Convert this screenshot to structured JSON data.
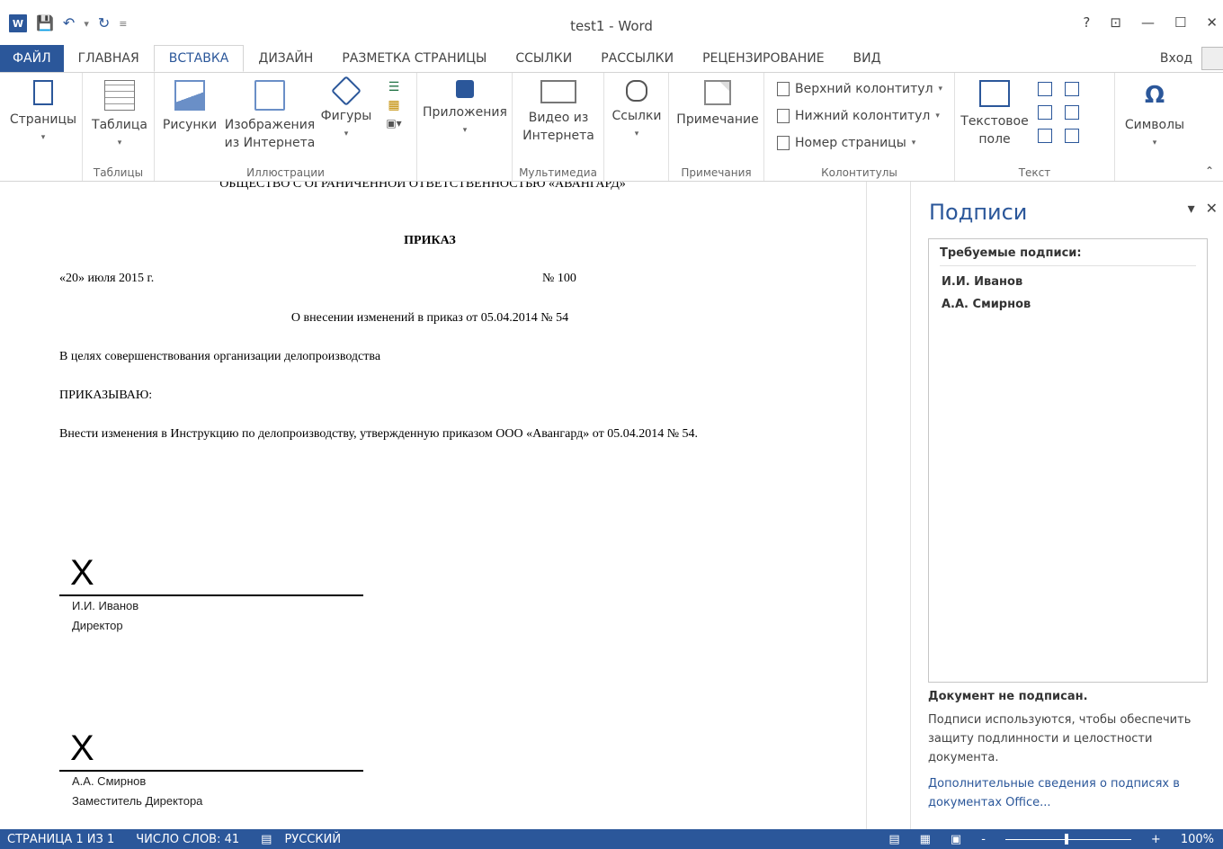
{
  "app": {
    "title": "test1 - Word",
    "logo": "W"
  },
  "window": {
    "help": "?",
    "ribbon_display": "⊡",
    "minimize": "—",
    "maximize": "☐",
    "close": "✕"
  },
  "tabs": {
    "file": "ФАЙЛ",
    "items": [
      "ГЛАВНАЯ",
      "ВСТАВКА",
      "ДИЗАЙН",
      "РАЗМЕТКА СТРАНИЦЫ",
      "ССЫЛКИ",
      "РАССЫЛКИ",
      "РЕЦЕНЗИРОВАНИЕ",
      "ВИД"
    ],
    "active": "ВСТАВКА",
    "signin": "Вход"
  },
  "ribbon": {
    "pages": "Страницы",
    "table": "Таблица",
    "group_tables": "Таблицы",
    "pictures": "Рисунки",
    "online_pictures_1": "Изображения",
    "online_pictures_2": "из Интернета",
    "shapes": "Фигуры",
    "group_illustrations": "Иллюстрации",
    "apps": "Приложения",
    "online_video_1": "Видео из",
    "online_video_2": "Интернета",
    "group_media": "Мультимедиа",
    "links": "Ссылки",
    "comment": "Примечание",
    "group_comments": "Примечания",
    "header": "Верхний колонтитул",
    "footer": "Нижний колонтитул",
    "page_number": "Номер страницы",
    "group_header_footer": "Колонтитулы",
    "textbox_1": "Текстовое",
    "textbox_2": "поле",
    "group_text": "Текст",
    "symbols": "Символы"
  },
  "document": {
    "company": "ОБЩЕСТВО С ОГРАНИЧЕННОЙ ОТВЕТСТВЕННОСТЬЮ «АВАНГАРД»",
    "heading": "ПРИКАЗ",
    "date": "«20» июля 2015 г.",
    "number": "№ 100",
    "subject": "О внесении изменений в приказ от 05.04.2014 № 54",
    "p1": "В целях совершенствования организации делопроизводства",
    "p2": "ПРИКАЗЫВАЮ:",
    "p3": "Внести изменения в Инструкцию по делопроизводству, утвержденную приказом ООО «Авангард» от 05.04.2014 № 54.",
    "signatures": [
      {
        "mark": "X",
        "name": "И.И. Иванов",
        "role": "Директор"
      },
      {
        "mark": "X",
        "name": "А.А. Смирнов",
        "role": "Заместитель Директора"
      }
    ]
  },
  "pane": {
    "title": "Подписи",
    "required_head": "Требуемые подписи:",
    "required": [
      "И.И. Иванов",
      "А.А. Смирнов"
    ],
    "status": "Документ не подписан.",
    "description": "Подписи используются, чтобы обеспечить защиту подлинности и целостности документа.",
    "link": "Дополнительные сведения о подписях в документах Office..."
  },
  "statusbar": {
    "page": "СТРАНИЦА 1 ИЗ 1",
    "words": "ЧИСЛО СЛОВ: 41",
    "language": "РУССКИЙ",
    "zoom": "100%",
    "zoom_minus": "-",
    "zoom_plus": "+"
  }
}
